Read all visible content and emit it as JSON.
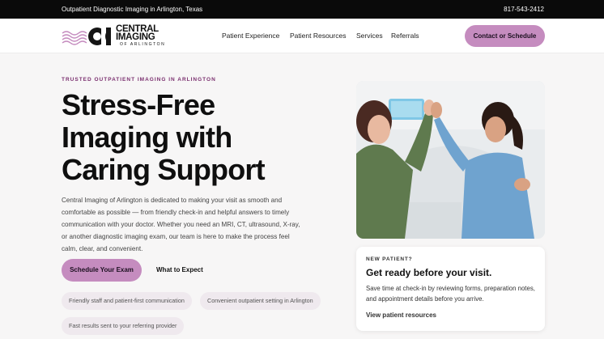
{
  "topbar": {
    "tagline": "Outpatient Diagnostic Imaging in Arlington, Texas",
    "phone": "817-543-2412"
  },
  "brand": {
    "name_line1": "CENTRAL",
    "name_line2": "IMAGING",
    "subtitle": "OF ARLINGTON",
    "accent_color": "#c58cbf"
  },
  "nav": {
    "items": [
      {
        "label": "Patient Experience"
      },
      {
        "label": "Patient Resources"
      },
      {
        "label": "Services"
      },
      {
        "label": "Referrals"
      }
    ],
    "cta": "Contact or Schedule"
  },
  "hero": {
    "eyebrow": "TRUSTED OUTPATIENT IMAGING IN ARLINGTON",
    "headline_lines": [
      "Stress-Free",
      "Imaging with",
      "Caring Support"
    ],
    "lede": "Central Imaging of Arlington is dedicated to making your visit as smooth and comfortable as possible — from friendly check-in and helpful answers to timely communication with your doctor. Whether you need an MRI, CT, ultrasound, X-ray, or another diagnostic imaging exam, our team is here to make the process feel calm, clear, and convenient.",
    "primary_button": "Schedule Your Exam",
    "secondary_link": "What to Expect",
    "chips": [
      "Friendly staff and patient-first communication",
      "Convenient outpatient setting in Arlington",
      "Fast results sent to your referring provider"
    ]
  },
  "photo": {
    "description_icon": "patient-high-five-photo"
  },
  "card": {
    "eyebrow": "NEW PATIENT?",
    "title": "Get ready before your visit.",
    "body": "Save time at check-in by reviewing forms, preparation notes, and appointment details before you arrive.",
    "link": "View patient resources"
  }
}
